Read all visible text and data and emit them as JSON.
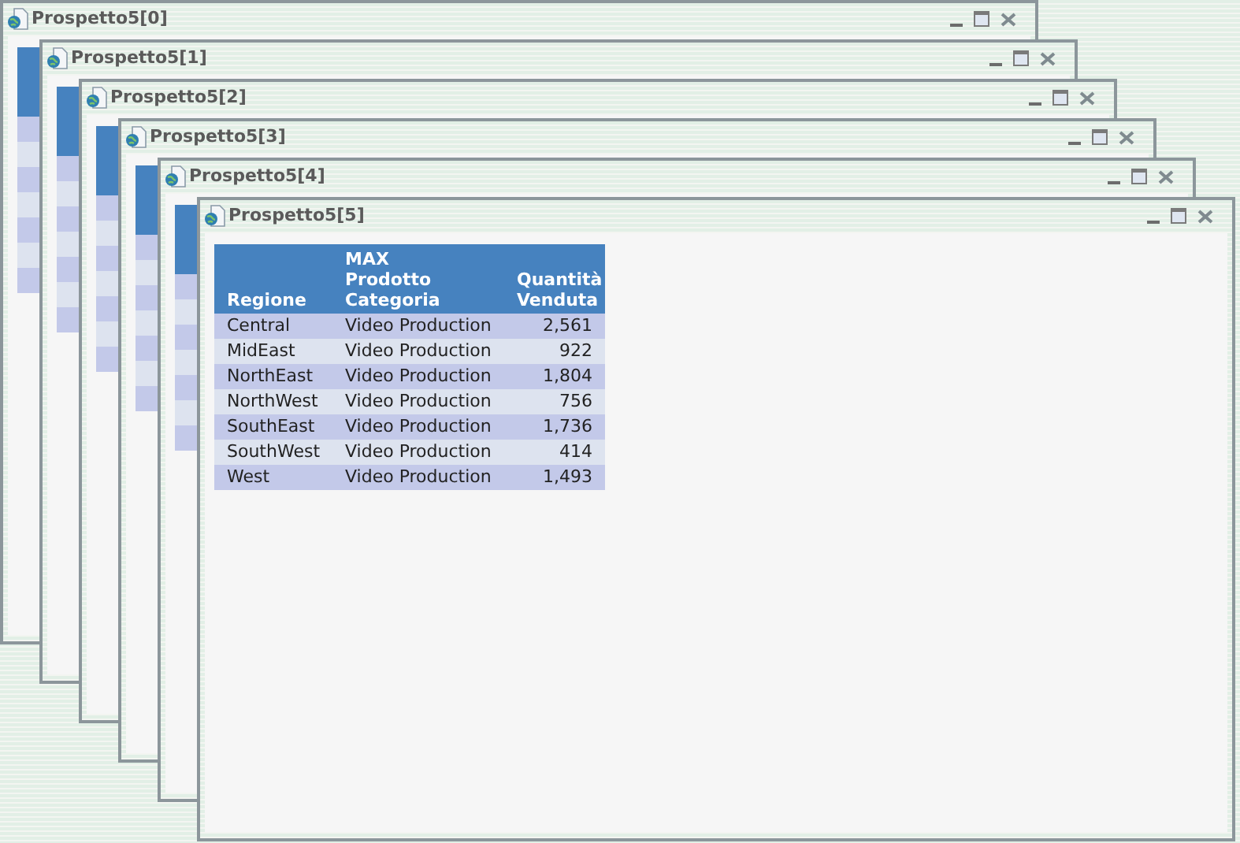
{
  "windows": [
    {
      "title": "Prospetto5[0]"
    },
    {
      "title": "Prospetto5[1]"
    },
    {
      "title": "Prospetto5[2]"
    },
    {
      "title": "Prospetto5[3]"
    },
    {
      "title": "Prospetto5[4]"
    },
    {
      "title": "Prospetto5[5]",
      "table": {
        "columns": [
          "Regione",
          "MAX\nProdotto\nCategoria",
          "Quantità\nVenduta"
        ],
        "rows": [
          [
            "Central",
            "Video Production",
            "2,561"
          ],
          [
            "MidEast",
            "Video Production",
            "922"
          ],
          [
            "NorthEast",
            "Video Production",
            "1,804"
          ],
          [
            "NorthWest",
            "Video Production",
            "756"
          ],
          [
            "SouthEast",
            "Video Production",
            "1,736"
          ],
          [
            "SouthWest",
            "Video Production",
            "414"
          ],
          [
            "West",
            "Video Production",
            "1,493"
          ]
        ]
      }
    }
  ]
}
